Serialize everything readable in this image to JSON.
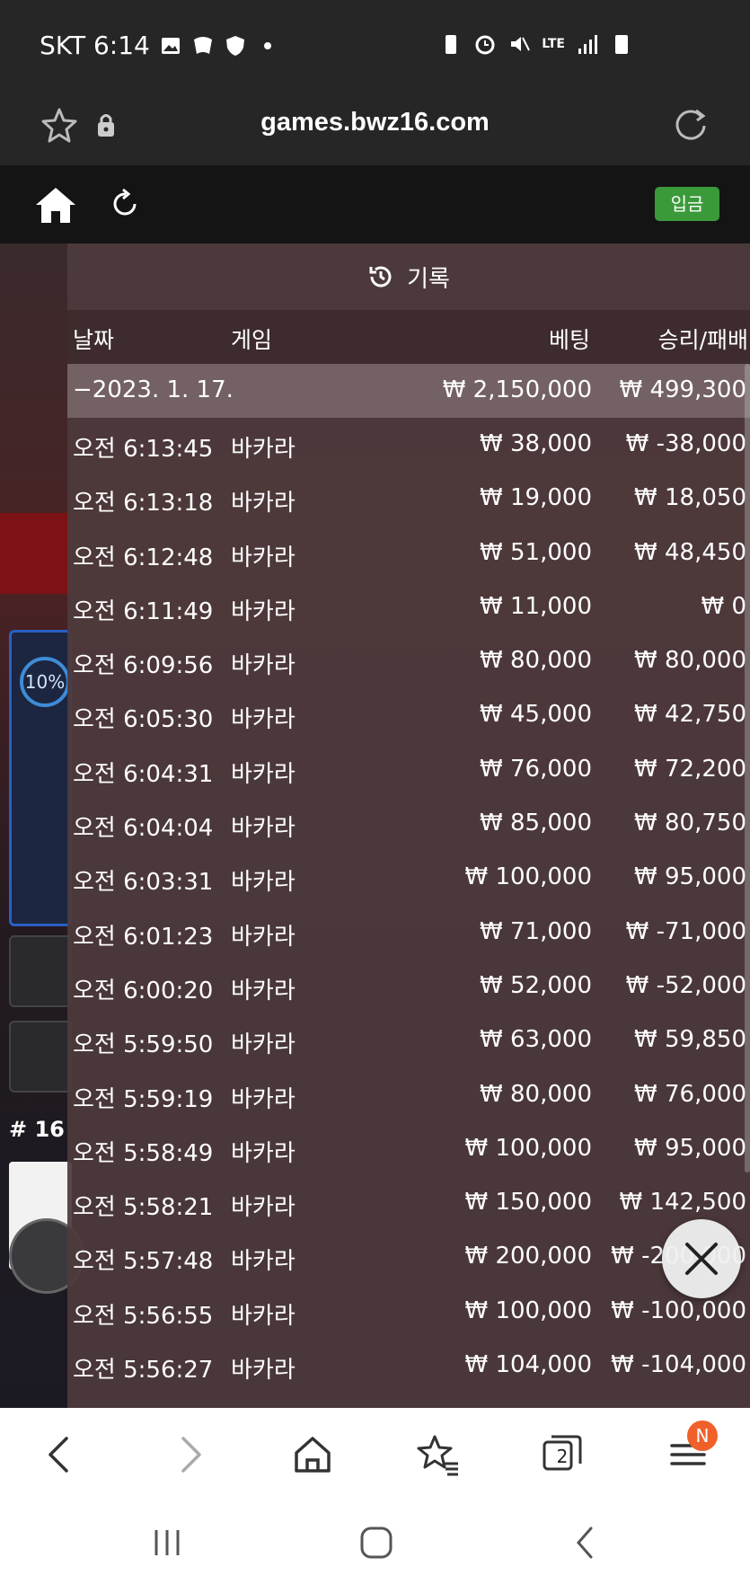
{
  "status_bar": {
    "carrier_time": "SKT 6:14",
    "network": "LTE"
  },
  "browser": {
    "url": "games.bwz16.com",
    "tab_count": "2",
    "menu_badge": "N"
  },
  "header": {
    "deposit_label": "입금"
  },
  "scene": {
    "percent": "10%",
    "round_label": "# 16"
  },
  "panel": {
    "title": "기록",
    "columns": {
      "date": "날짜",
      "game": "게임",
      "bet": "베팅",
      "win_loss": "승리/패배"
    },
    "summary": {
      "date": "−2023. 1. 17.",
      "bet": "₩ 2,150,000",
      "win_loss": "₩ 499,300"
    },
    "rows": [
      {
        "time": "오전 6:13:45",
        "game": "바카라",
        "bet": "₩ 38,000",
        "win_loss": "₩ -38,000"
      },
      {
        "time": "오전 6:13:18",
        "game": "바카라",
        "bet": "₩ 19,000",
        "win_loss": "₩ 18,050"
      },
      {
        "time": "오전 6:12:48",
        "game": "바카라",
        "bet": "₩ 51,000",
        "win_loss": "₩ 48,450"
      },
      {
        "time": "오전 6:11:49",
        "game": "바카라",
        "bet": "₩ 11,000",
        "win_loss": "₩ 0"
      },
      {
        "time": "오전 6:09:56",
        "game": "바카라",
        "bet": "₩ 80,000",
        "win_loss": "₩ 80,000"
      },
      {
        "time": "오전 6:05:30",
        "game": "바카라",
        "bet": "₩ 45,000",
        "win_loss": "₩ 42,750"
      },
      {
        "time": "오전 6:04:31",
        "game": "바카라",
        "bet": "₩ 76,000",
        "win_loss": "₩ 72,200"
      },
      {
        "time": "오전 6:04:04",
        "game": "바카라",
        "bet": "₩ 85,000",
        "win_loss": "₩ 80,750"
      },
      {
        "time": "오전 6:03:31",
        "game": "바카라",
        "bet": "₩ 100,000",
        "win_loss": "₩ 95,000"
      },
      {
        "time": "오전 6:01:23",
        "game": "바카라",
        "bet": "₩ 71,000",
        "win_loss": "₩ -71,000"
      },
      {
        "time": "오전 6:00:20",
        "game": "바카라",
        "bet": "₩ 52,000",
        "win_loss": "₩ -52,000"
      },
      {
        "time": "오전 5:59:50",
        "game": "바카라",
        "bet": "₩ 63,000",
        "win_loss": "₩ 59,850"
      },
      {
        "time": "오전 5:59:19",
        "game": "바카라",
        "bet": "₩ 80,000",
        "win_loss": "₩ 76,000"
      },
      {
        "time": "오전 5:58:49",
        "game": "바카라",
        "bet": "₩ 100,000",
        "win_loss": "₩ 95,000"
      },
      {
        "time": "오전 5:58:21",
        "game": "바카라",
        "bet": "₩ 150,000",
        "win_loss": "₩ 142,500"
      },
      {
        "time": "오전 5:57:48",
        "game": "바카라",
        "bet": "₩ 200,000",
        "win_loss": "₩ -200,000"
      },
      {
        "time": "오전 5:56:55",
        "game": "바카라",
        "bet": "₩ 100,000",
        "win_loss": "₩ -100,000"
      },
      {
        "time": "오전 5:56:27",
        "game": "바카라",
        "bet": "₩ 104,000",
        "win_loss": "₩ -104,000"
      }
    ]
  }
}
